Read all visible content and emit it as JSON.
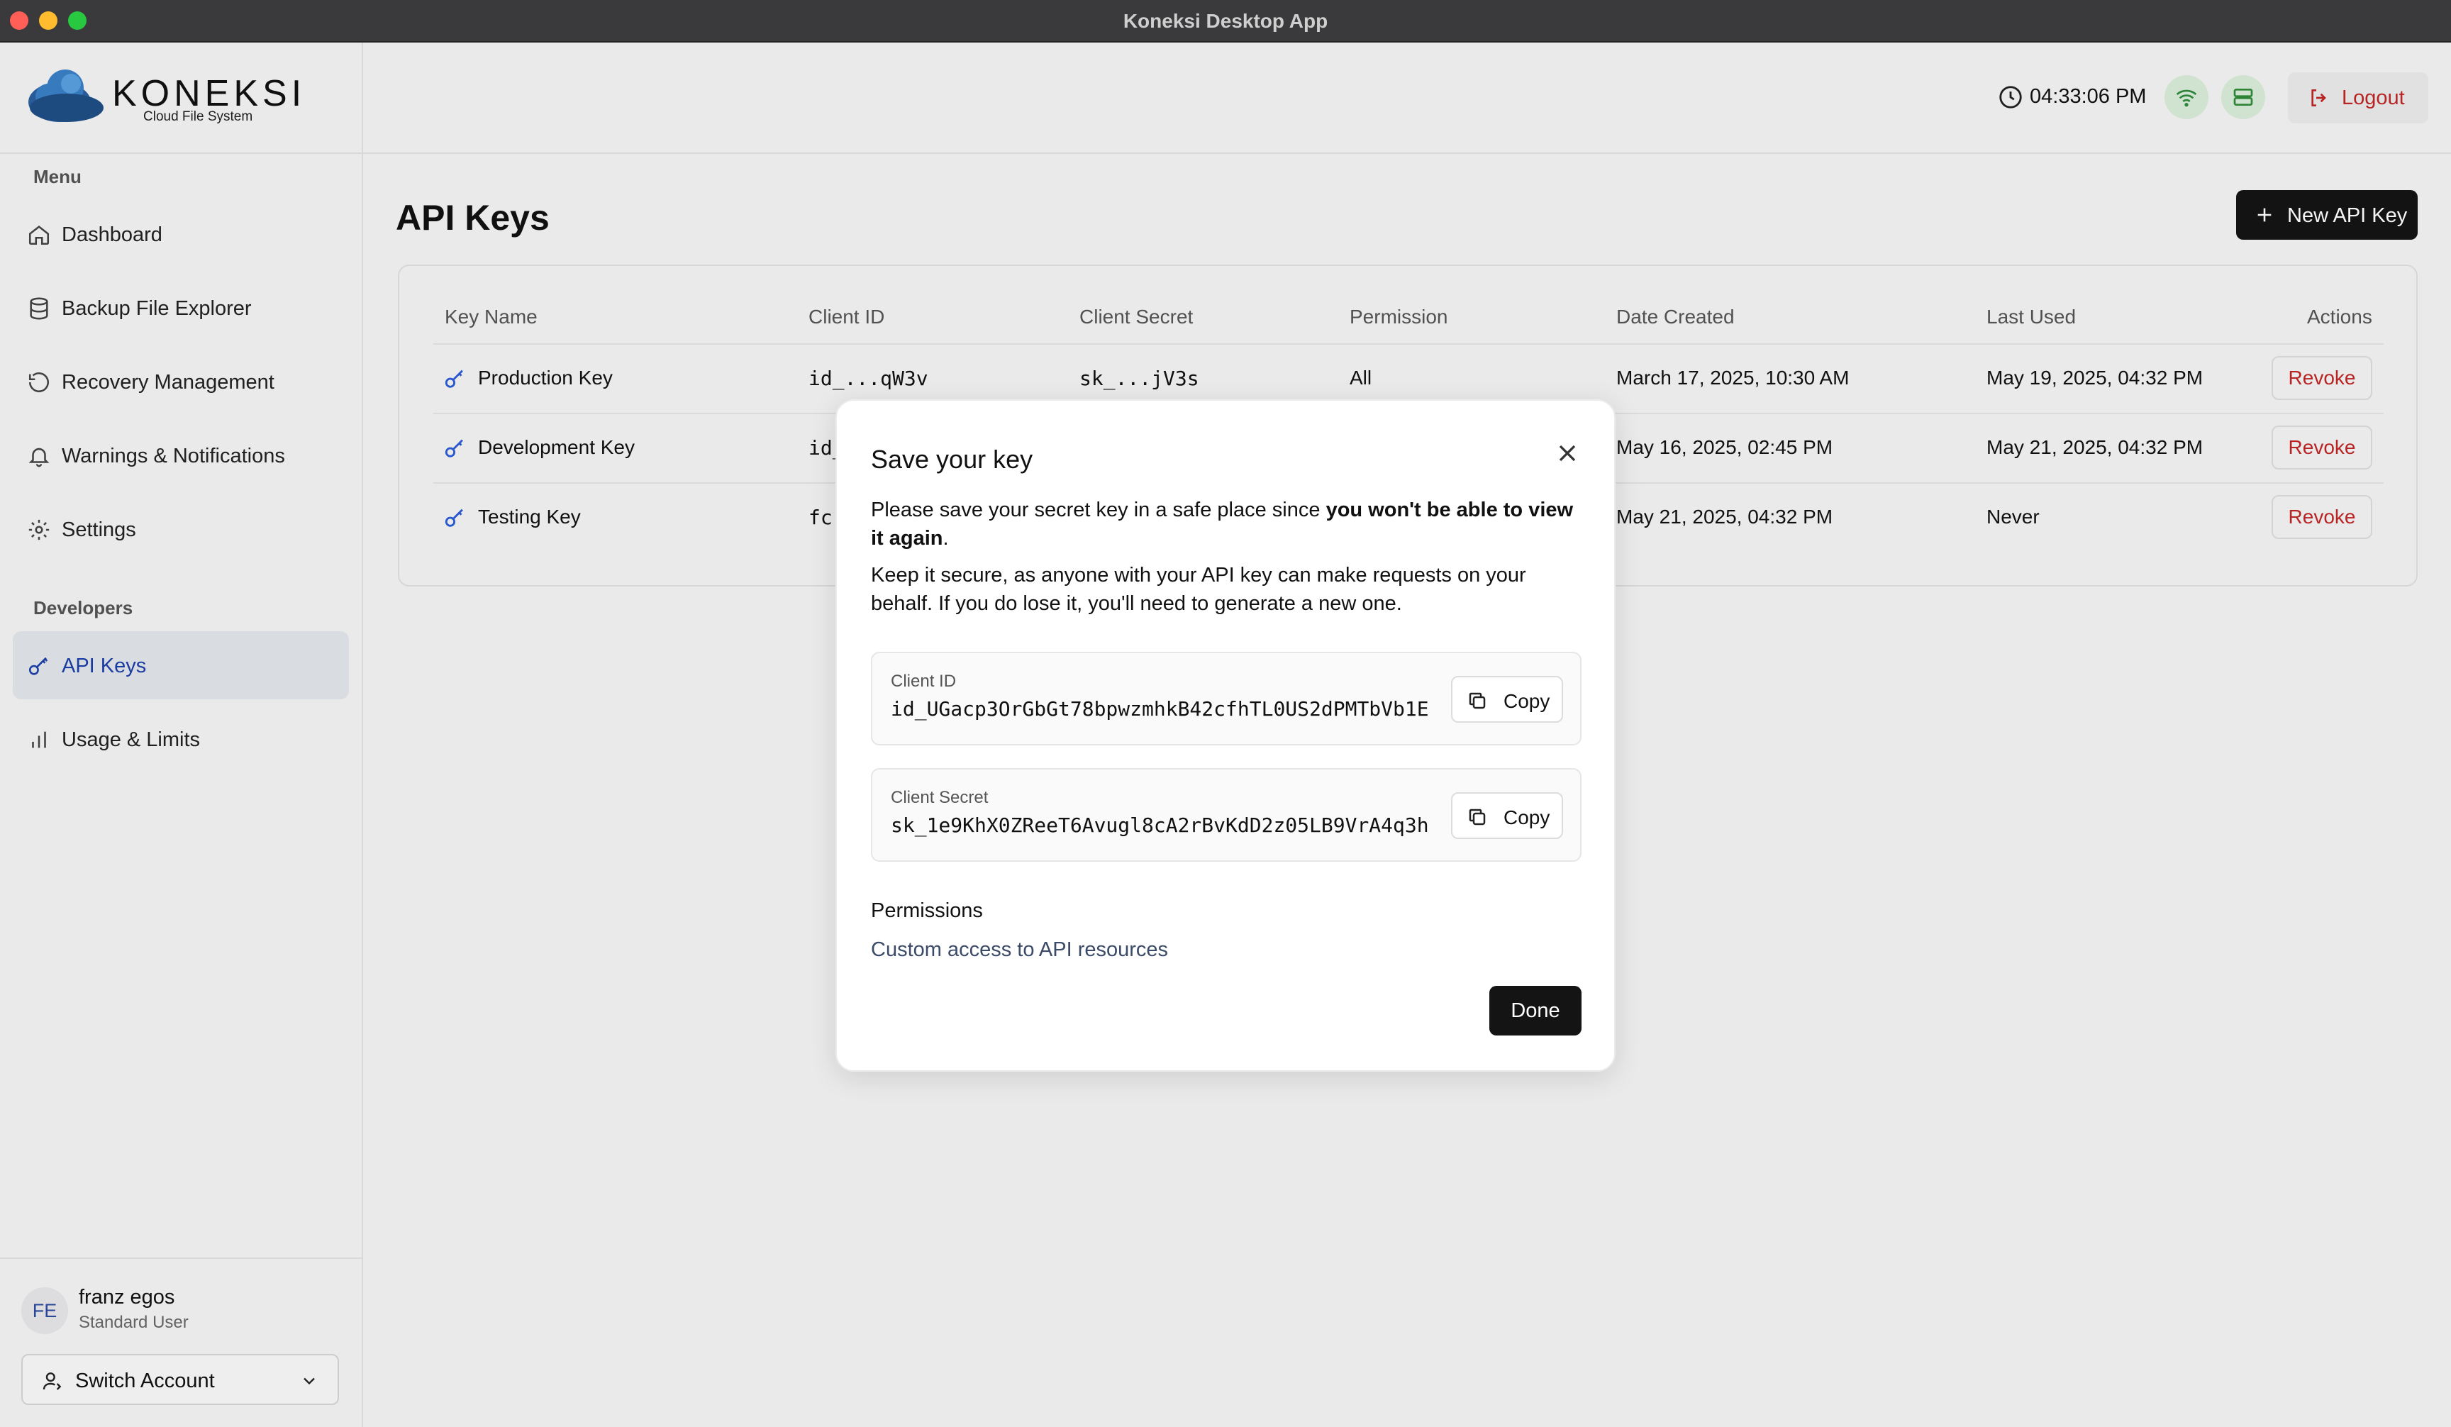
{
  "window": {
    "title": "Koneksi Desktop App"
  },
  "brand": {
    "name": "KONEKSI",
    "tagline": "Cloud File System"
  },
  "sidebar": {
    "menu_label": "Menu",
    "menu_items": [
      {
        "label": "Dashboard",
        "icon": "home-icon"
      },
      {
        "label": "Backup File Explorer",
        "icon": "database-icon"
      },
      {
        "label": "Recovery Management",
        "icon": "history-icon"
      },
      {
        "label": "Warnings & Notifications",
        "icon": "bell-icon"
      },
      {
        "label": "Settings",
        "icon": "gear-icon"
      }
    ],
    "developers_label": "Developers",
    "developer_items": [
      {
        "label": "API Keys",
        "icon": "key-icon",
        "active": true
      },
      {
        "label": "Usage & Limits",
        "icon": "bar-chart-icon"
      }
    ],
    "user": {
      "initials": "FE",
      "name": "franz egos",
      "role": "Standard User"
    },
    "switch_account_label": "Switch Account"
  },
  "header": {
    "time": "04:33:06 PM",
    "logout_label": "Logout",
    "accent_danger": "#c02626",
    "status_color": "#d9ecd9"
  },
  "main": {
    "title": "API Keys",
    "new_key_label": "New API Key",
    "table": {
      "columns": [
        "Key Name",
        "Client ID",
        "Client Secret",
        "Permission",
        "Date Created",
        "Last Used",
        "Actions"
      ],
      "rows": [
        {
          "name": "Production Key",
          "client_id": "id_...qW3v",
          "client_secret": "sk_...jV3s",
          "permission": "All",
          "created": "March 17, 2025, 10:30 AM",
          "last_used": "May 19, 2025, 04:32 PM",
          "action": "Revoke"
        },
        {
          "name": "Development Key",
          "client_id": "id_",
          "client_secret": "",
          "permission": "",
          "created": "May 16, 2025, 02:45 PM",
          "last_used": "May 21, 2025, 04:32 PM",
          "action": "Revoke"
        },
        {
          "name": "Testing Key",
          "client_id": "fc",
          "client_secret": "",
          "permission": "",
          "created": "May 21, 2025, 04:32 PM",
          "last_used": "Never",
          "action": "Revoke"
        }
      ]
    }
  },
  "modal": {
    "title": "Save your key",
    "p1_normal": "Please save your secret key in a safe place since ",
    "p1_bold": "you won't be able to view it again",
    "p1_end": ".",
    "p2": "Keep it secure, as anyone with your API key can make requests on your behalf. If you do lose it, you'll need to generate a new one.",
    "client_id_label": "Client ID",
    "client_id_value": "id_UGacp3OrGbGt78bpwzmhkB42cfhTL0US2dPMTbVb1E",
    "client_secret_label": "Client Secret",
    "client_secret_value": "sk_1e9KhX0ZReeT6Avugl8cA2rBvKdD2z05LB9VrA4q3h",
    "copy_label": "Copy",
    "permissions_title": "Permissions",
    "permissions_desc": "Custom access to API resources",
    "done_label": "Done"
  }
}
